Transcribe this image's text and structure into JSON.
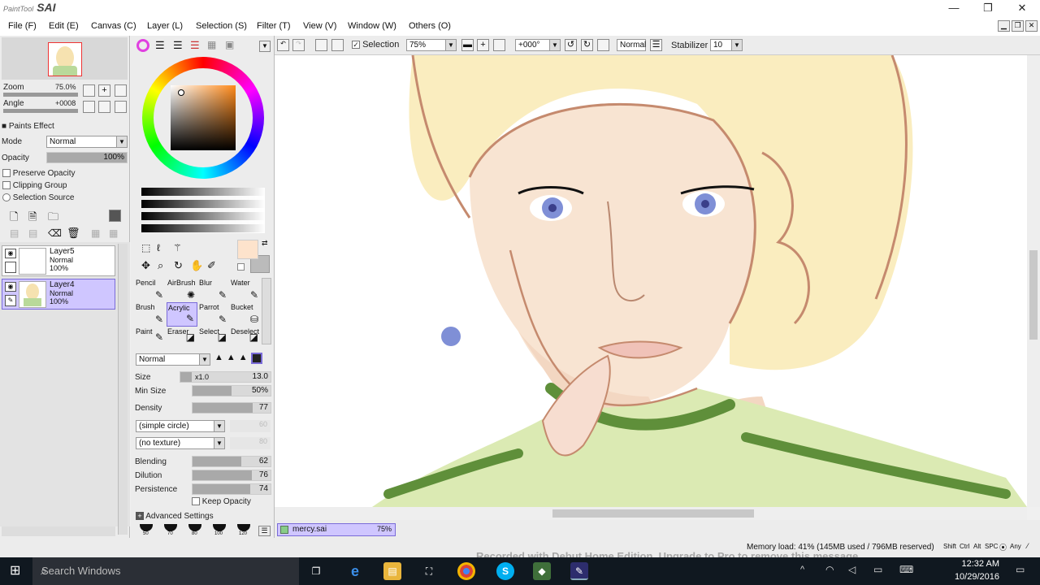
{
  "app": {
    "logo_sub": "PaintTool",
    "logo_main": "SAI"
  },
  "window_controls": {
    "minimize": "—",
    "maximize": "❐",
    "close": "✕"
  },
  "menu": [
    "File (F)",
    "Edit (E)",
    "Canvas (C)",
    "Layer (L)",
    "Selection (S)",
    "Filter (T)",
    "View (V)",
    "Window (W)",
    "Others (O)"
  ],
  "navigator": {
    "zoom_label": "Zoom",
    "zoom_value": "75.0%",
    "angle_label": "Angle",
    "angle_value": "+0008"
  },
  "paints_effect": {
    "header": "Paints Effect",
    "mode_label": "Mode",
    "mode_value": "Normal",
    "opacity_label": "Opacity",
    "opacity_value": "100%",
    "opacity_level": 1.0,
    "preserve_opacity": "Preserve Opacity",
    "clipping_group": "Clipping Group",
    "selection_source": "Selection Source"
  },
  "layers": [
    {
      "name": "Layer5",
      "mode": "Normal",
      "opacity": "100%",
      "active": false
    },
    {
      "name": "Layer4",
      "mode": "Normal",
      "opacity": "100%",
      "active": true
    }
  ],
  "colors": {
    "current": "#fde3cc",
    "secondary": "#bbbbbb",
    "accent": "#7a6bd8",
    "canvas_skin": "#f8e4d2",
    "hair": "#faedbf"
  },
  "tools": [
    {
      "name": "Pencil",
      "icon": "pencil-icon",
      "glyph": "✎"
    },
    {
      "name": "AirBrush",
      "icon": "airbrush-icon",
      "glyph": "✺"
    },
    {
      "name": "Blur",
      "icon": "blur-icon",
      "glyph": "✎"
    },
    {
      "name": "Water",
      "icon": "water-icon",
      "glyph": "✎"
    },
    {
      "name": "Brush",
      "icon": "brush-icon",
      "glyph": "✎"
    },
    {
      "name": "Acrylic",
      "icon": "acrylic-icon",
      "glyph": "✎",
      "active": true
    },
    {
      "name": "Parrot",
      "icon": "parrot-icon",
      "glyph": "✎"
    },
    {
      "name": "Bucket",
      "icon": "bucket-icon",
      "glyph": "⛁"
    },
    {
      "name": "Paint",
      "icon": "paint-icon",
      "glyph": "✎"
    },
    {
      "name": "Eraser",
      "icon": "eraser-icon",
      "glyph": "◪"
    },
    {
      "name": "Select",
      "icon": "select-icon",
      "glyph": "◪"
    },
    {
      "name": "Deselect",
      "icon": "deselect-icon",
      "glyph": "◪"
    }
  ],
  "brush": {
    "blend_mode": "Normal",
    "size_label": "Size",
    "size_mult": "x1.0",
    "size_value": "13.0",
    "min_size_label": "Min Size",
    "min_size_value": "50%",
    "min_size_level": 0.5,
    "density_label": "Density",
    "density_value": "77",
    "density_level": 0.77,
    "shape": "(simple circle)",
    "shape_value": "60",
    "texture": "(no texture)",
    "texture_value": "80",
    "blending_label": "Blending",
    "blending_value": "62",
    "blending_level": 0.62,
    "dilution_label": "Dilution",
    "dilution_value": "76",
    "dilution_level": 0.76,
    "persistence_label": "Persistence",
    "persistence_value": "74",
    "persistence_level": 0.74,
    "keep_opacity": "Keep Opacity",
    "advanced": "Advanced Settings",
    "size_presets": [
      "50",
      "70",
      "80",
      "100",
      "120"
    ]
  },
  "toolbar": {
    "selection_label": "Selection",
    "selection_checked": true,
    "zoom_value": "75%",
    "angle_value": "+000°",
    "blend_mode": "Normal",
    "stabilizer_label": "Stabilizer",
    "stabilizer_value": "10"
  },
  "document": {
    "name": "mercy.sai",
    "zoom": "75%"
  },
  "status": {
    "memory": "Memory load: 41% (145MB used / 796MB reserved)",
    "watermark": "Recorded with Debut Home Edition. Upgrade to Pro to remove this message",
    "keys": [
      "Shift",
      "Ctrl",
      "Alt",
      "SPC",
      "⦿",
      "Any",
      "⁄"
    ]
  },
  "taskbar": {
    "search_placeholder": "Search Windows",
    "time": "12:32 AM",
    "date": "10/29/2016"
  }
}
